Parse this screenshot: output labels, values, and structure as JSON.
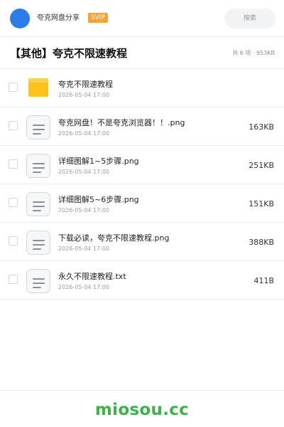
{
  "header": {
    "brand": "夸克网盘分享",
    "badge": "SVIP",
    "search_label": "搜索",
    "avatar_color": "#2b7de9",
    "badge_color": "#f7a233"
  },
  "folder": {
    "title": "【其他】夸克不限速教程",
    "meta": "共 6 项 · 953KB"
  },
  "files": [
    {
      "name": "夸克不限速教程",
      "date": "2026-05-04 17:00",
      "size": "",
      "icon": "folder-icon"
    },
    {
      "name": "夸克网盘！不是夸克浏览器！！.png",
      "date": "2026-05-04 17:00",
      "size": "163KB",
      "icon": "document-icon"
    },
    {
      "name": "详细图解1~5步骤.png",
      "date": "2026-05-04 17:00",
      "size": "251KB",
      "icon": "document-icon"
    },
    {
      "name": "详细图解5~6步骤.png",
      "date": "2026-05-04 17:00",
      "size": "151KB",
      "icon": "document-icon"
    },
    {
      "name": "下载必读，夸克不限速教程.png",
      "date": "2026-05-04 17:00",
      "size": "388KB",
      "icon": "document-icon"
    },
    {
      "name": "永久不限速教程.txt",
      "date": "2026-05-04 17:00",
      "size": "411B",
      "icon": "document-icon"
    }
  ],
  "footer": {
    "watermark": "miosou.cc",
    "watermark_color": "#3cb24a"
  }
}
